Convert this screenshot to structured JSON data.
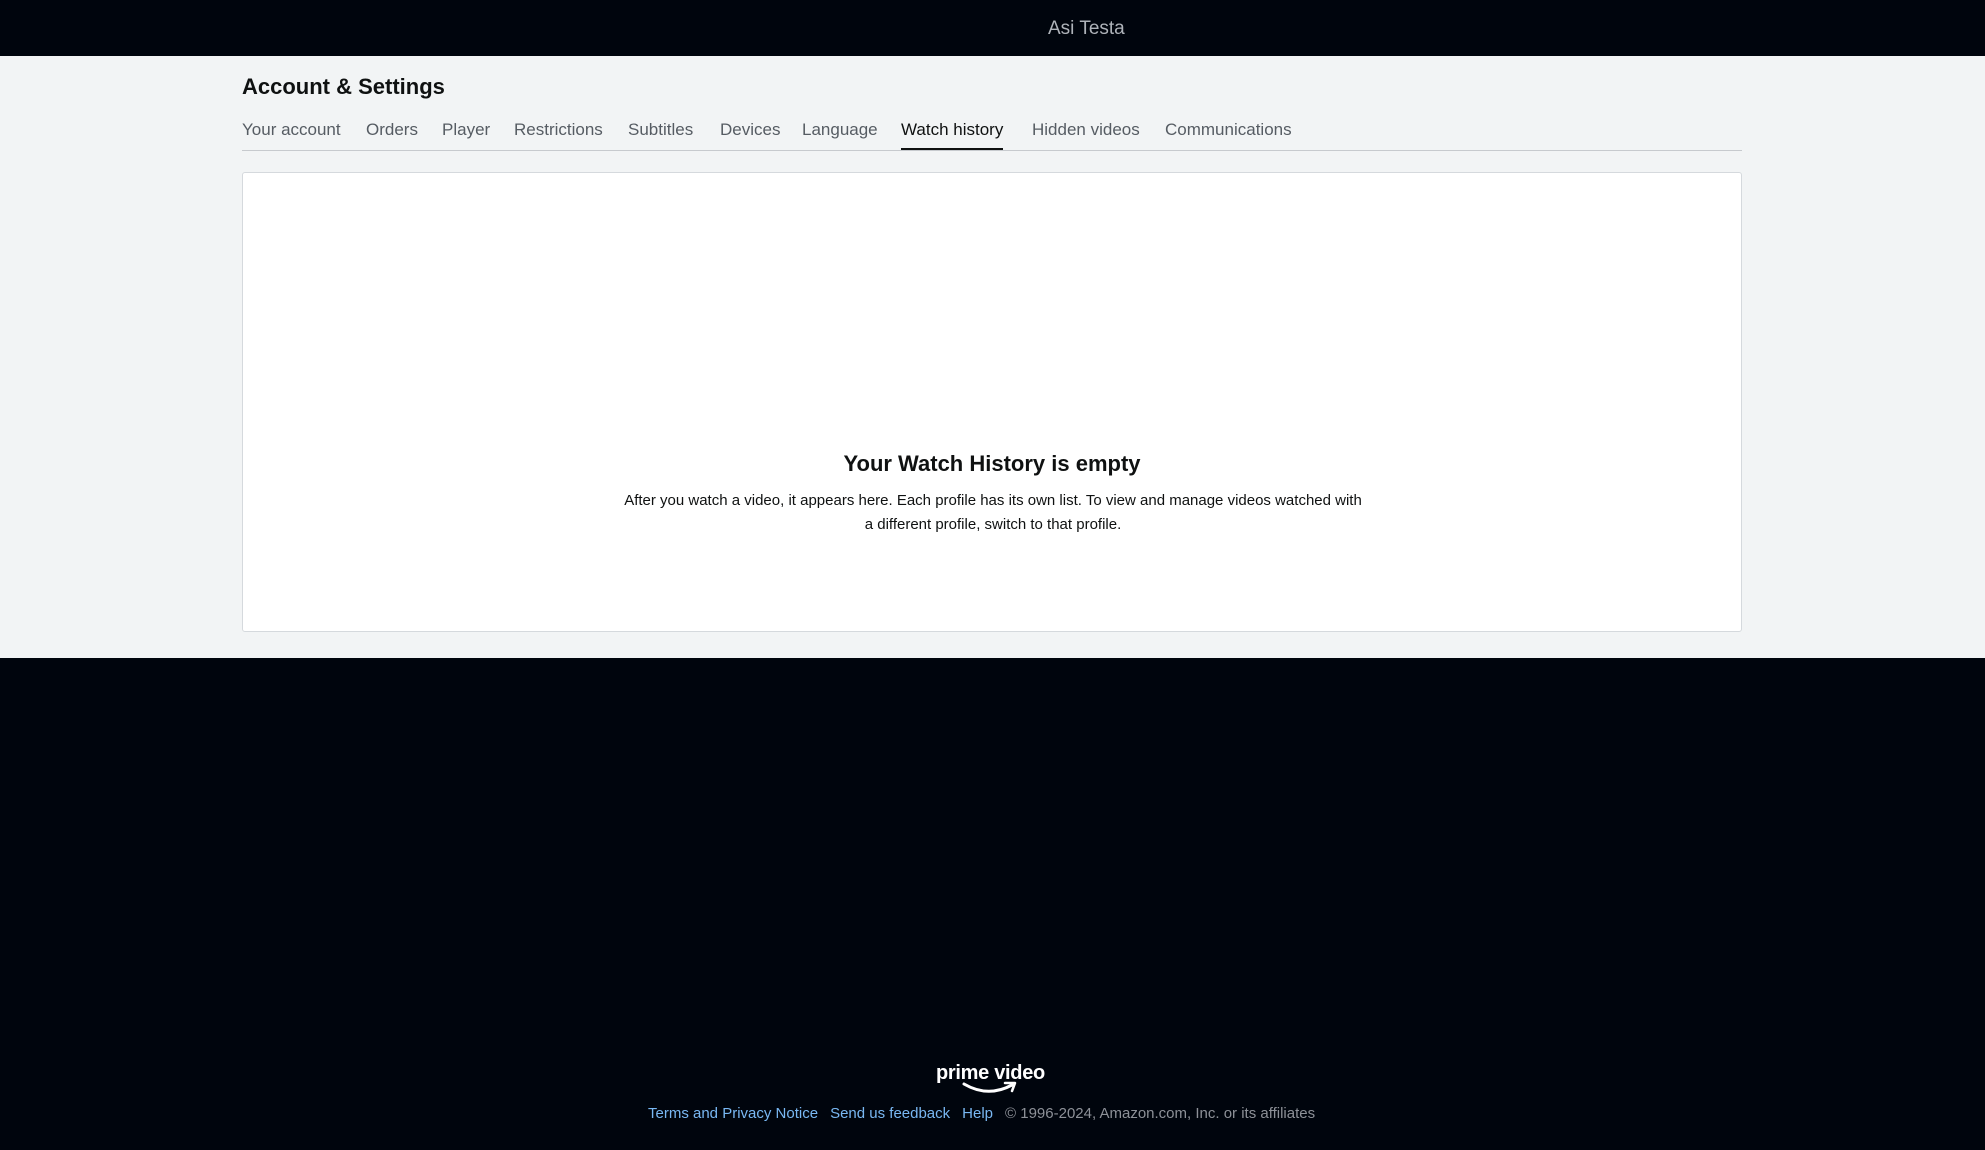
{
  "header": {
    "user_name": "Asi Testa"
  },
  "page": {
    "title": "Account & Settings",
    "tabs": [
      {
        "label": "Your account",
        "active": false
      },
      {
        "label": "Orders",
        "active": false
      },
      {
        "label": "Player",
        "active": false
      },
      {
        "label": "Restrictions",
        "active": false
      },
      {
        "label": "Subtitles",
        "active": false
      },
      {
        "label": "Devices",
        "active": false
      },
      {
        "label": "Language",
        "active": false
      },
      {
        "label": "Watch history",
        "active": true
      },
      {
        "label": "Hidden videos",
        "active": false
      },
      {
        "label": "Communications",
        "active": false
      }
    ]
  },
  "empty_state": {
    "title": "Your Watch History is empty",
    "description": "After you watch a video, it appears here. Each profile has its own list. To view and manage videos watched with a different profile, switch to that profile."
  },
  "footer": {
    "logo_text": "prime video",
    "links": [
      {
        "label": "Terms and Privacy Notice"
      },
      {
        "label": "Send us feedback"
      },
      {
        "label": "Help"
      }
    ],
    "copyright": "© 1996-2024, Amazon.com, Inc. or its affiliates"
  },
  "colors": {
    "header_bg": "#00050d",
    "page_bg": "#f2f4f5",
    "link": "#79b8f3"
  }
}
